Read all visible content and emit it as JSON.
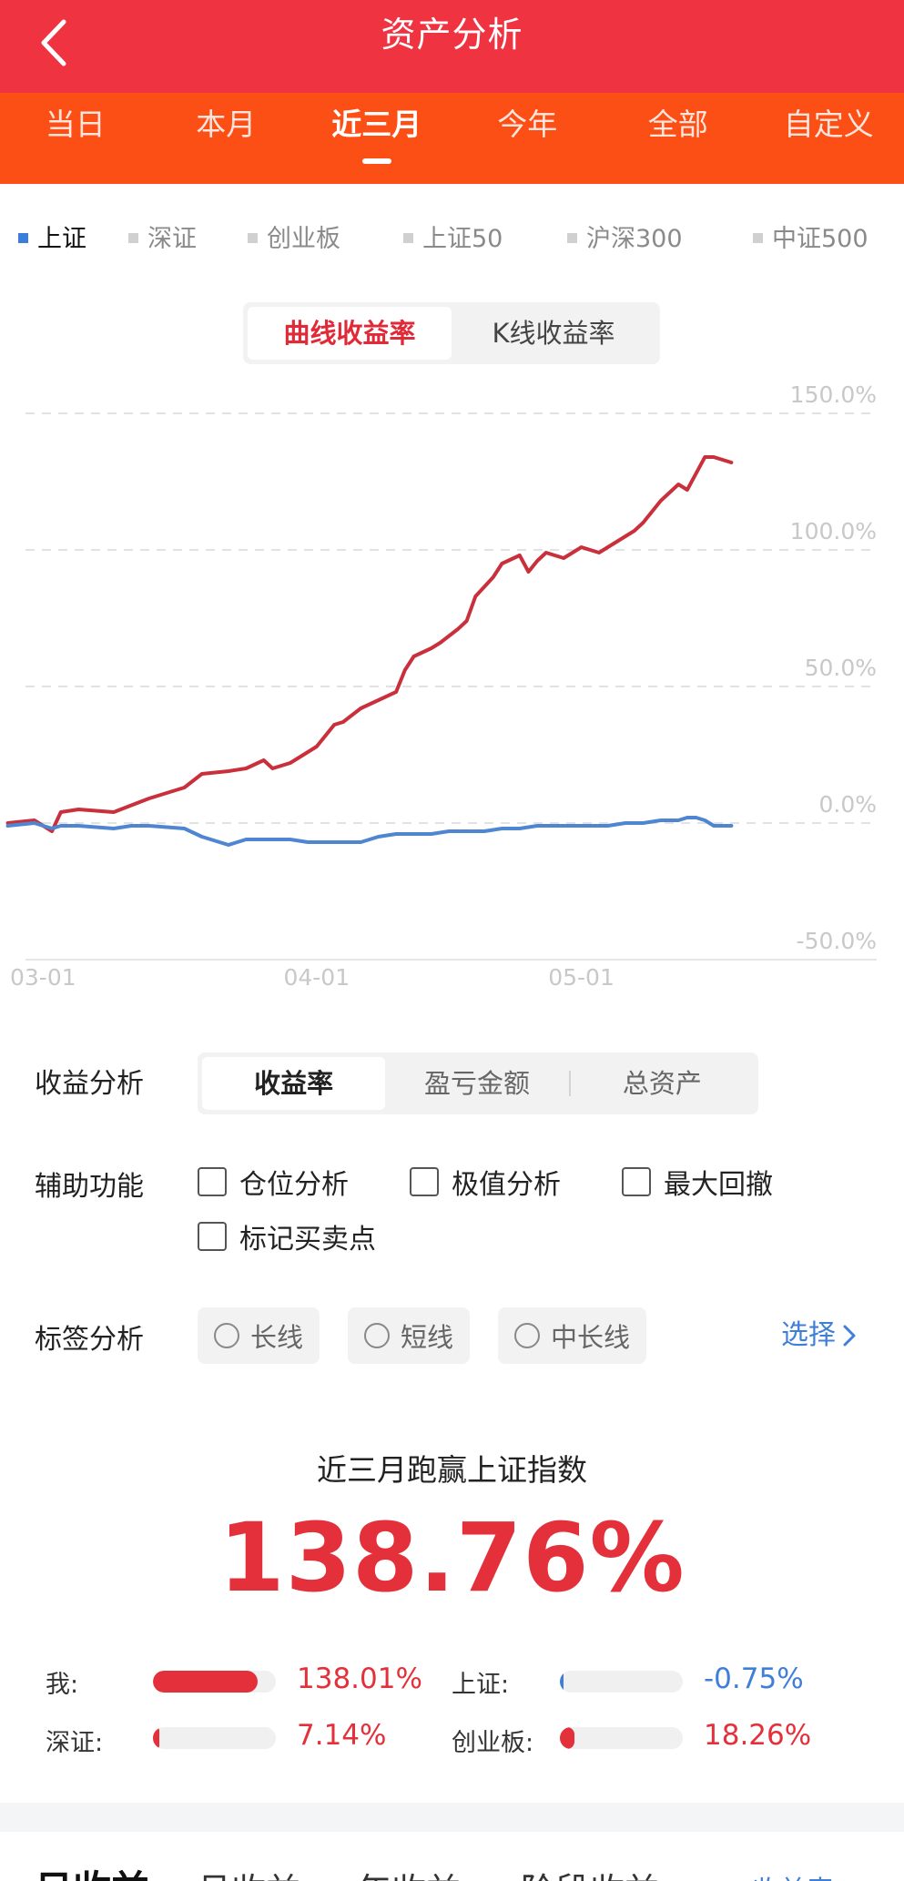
{
  "header": {
    "title": "资产分析"
  },
  "period_tabs": [
    {
      "label": "当日",
      "active": false
    },
    {
      "label": "本月",
      "active": false
    },
    {
      "label": "近三月",
      "active": true
    },
    {
      "label": "今年",
      "active": false
    },
    {
      "label": "全部",
      "active": false
    },
    {
      "label": "自定义",
      "active": false
    }
  ],
  "index_filters": [
    {
      "label": "上证",
      "active": true
    },
    {
      "label": "深证",
      "active": false
    },
    {
      "label": "创业板",
      "active": false
    },
    {
      "label": "上证50",
      "active": false
    },
    {
      "label": "沪深300",
      "active": false
    },
    {
      "label": "中证500",
      "active": false
    }
  ],
  "chart_toggle": {
    "curve": "曲线收益率",
    "kline": "K线收益率",
    "active": "curve"
  },
  "colors": {
    "title_bar": "#ef3340",
    "tab_bar": "#fc4f16",
    "my_series": "#c9303b",
    "index_series": "#4f86d1",
    "accent_red": "#e3303a",
    "accent_blue": "#3f7fd8"
  },
  "chart_data": {
    "type": "line",
    "x_ticks": [
      "03-01",
      "04-01",
      "05-01"
    ],
    "y_ticks": [
      "150.0%",
      "100.0%",
      "50.0%",
      "0.0%",
      "-50.0%"
    ],
    "ylim": [
      -50,
      150
    ],
    "x_range_days": [
      0,
      91
    ],
    "x_tick_days": [
      0,
      31,
      61
    ],
    "grid": true,
    "legend": "none",
    "series": [
      {
        "key": "mine",
        "color": "#c9303b",
        "x": [
          -2,
          1,
          3,
          4,
          6,
          10,
          14,
          16,
          18,
          20,
          23,
          25,
          27,
          28,
          30,
          31,
          33,
          35,
          36,
          38,
          40,
          42,
          43,
          44,
          46,
          47,
          49,
          50,
          51,
          53,
          54,
          56,
          57,
          58,
          59,
          61,
          63,
          65,
          69,
          70,
          72,
          74,
          75,
          77,
          78,
          80
        ],
        "y": [
          0,
          1,
          -3,
          4,
          5,
          4,
          9,
          11,
          13,
          18,
          19,
          20,
          23,
          20,
          22,
          24,
          28,
          36,
          37,
          42,
          45,
          48,
          56,
          61,
          64,
          66,
          71,
          74,
          83,
          90,
          95,
          98,
          92,
          96,
          99,
          97,
          101,
          99,
          107,
          110,
          118,
          124,
          122,
          134,
          134,
          132
        ]
      },
      {
        "key": "index",
        "color": "#4f86d1",
        "x": [
          -2,
          1,
          3,
          4,
          6,
          10,
          12,
          14,
          18,
          20,
          23,
          25,
          27,
          30,
          32,
          34,
          38,
          40,
          42,
          44,
          46,
          48,
          50,
          52,
          54,
          56,
          58,
          60,
          62,
          64,
          66,
          68,
          70,
          72,
          74,
          75,
          76,
          77,
          78,
          80
        ],
        "y": [
          -1,
          0,
          -2,
          -1,
          -1,
          -2,
          -1,
          -1,
          -2,
          -5,
          -8,
          -6,
          -6,
          -6,
          -7,
          -7,
          -7,
          -5,
          -4,
          -4,
          -4,
          -3,
          -3,
          -3,
          -2,
          -2,
          -1,
          -1,
          -1,
          -1,
          -1,
          0,
          0,
          1,
          1,
          2,
          2,
          1,
          -1,
          -1
        ]
      }
    ]
  },
  "profit_analysis": {
    "label": "收益分析",
    "options": [
      "收益率",
      "盈亏金额",
      "总资产"
    ],
    "active_index": 0
  },
  "aux_functions": {
    "label": "辅助功能",
    "options": [
      "仓位分析",
      "极值分析",
      "最大回撤",
      "标记买卖点"
    ]
  },
  "tag_analysis": {
    "label": "标签分析",
    "chips": [
      "长线",
      "短线",
      "中长线"
    ],
    "select_label": "选择"
  },
  "beat": {
    "caption": "近三月跑赢上证指数",
    "value": "138.76%"
  },
  "comparisons": [
    {
      "label": "我:",
      "value": "138.01%",
      "fill": 0.85,
      "color": "#e3303a",
      "value_color": "#e3303a"
    },
    {
      "label": "上证:",
      "value": "-0.75%",
      "fill": 0.01,
      "color": "#3f7fd8",
      "value_color": "#3f7fd8"
    },
    {
      "label": "深证:",
      "value": "7.14%",
      "fill": 0.05,
      "color": "#e3303a",
      "value_color": "#e3303a"
    },
    {
      "label": "创业板:",
      "value": "18.26%",
      "fill": 0.12,
      "color": "#e3303a",
      "value_color": "#e3303a"
    }
  ],
  "bottom_tabs": {
    "tabs": [
      "日收益",
      "月收益",
      "年收益",
      "阶段收益"
    ],
    "active_index": 0,
    "link": "收益表"
  }
}
